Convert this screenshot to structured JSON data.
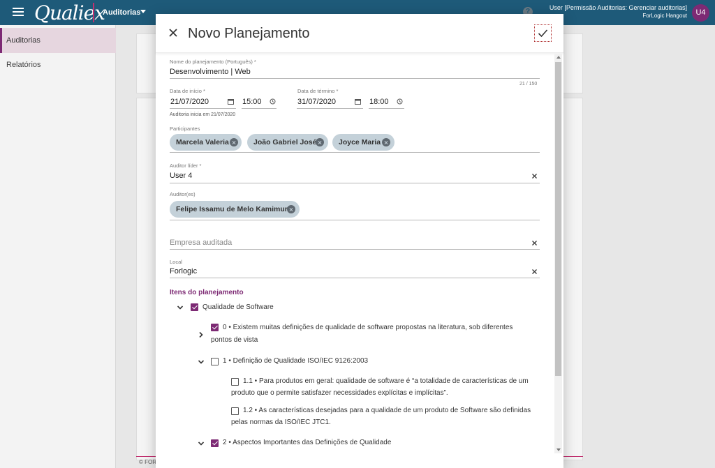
{
  "topbar": {
    "logo": "Qualiex",
    "module": "Auditorias",
    "help": "?",
    "user_name": "User [Permissão Auditorias: Gerenciar auditorias]",
    "user_company": "ForLogic Hangout",
    "avatar_initials": "U4"
  },
  "sidebar": {
    "items": [
      {
        "label": "Auditorias",
        "active": true
      },
      {
        "label": "Relatórios",
        "active": false
      }
    ]
  },
  "background": {
    "footer_text": "© FOR"
  },
  "dialog": {
    "title": "Novo Planejamento",
    "name_field": {
      "label": "Nome do planejamento (Português) *",
      "value": "Desenvolvimento | Web",
      "counter": "21 / 150"
    },
    "start_date": {
      "label": "Data de início *",
      "date": "21/07/2020",
      "time": "15:00",
      "hint": "Auditoria inicia em 21/07/2020"
    },
    "end_date": {
      "label": "Data de término *",
      "date": "31/07/2020",
      "time": "18:00"
    },
    "participants": {
      "label": "Participantes",
      "chips": [
        "Marcela Valeria",
        "João Gabriel José",
        "Joyce Maria"
      ]
    },
    "lead_auditor": {
      "label": "Auditor líder *",
      "value": "User 4"
    },
    "auditors": {
      "label": "Auditor(es)",
      "chips": [
        "Felipe Issamu de Melo Kamimura"
      ]
    },
    "company": {
      "placeholder": "Empresa auditada"
    },
    "location": {
      "label": "Local",
      "value": "Forlogic"
    },
    "items_section": {
      "title": "Itens do planejamento",
      "root": {
        "label": "Qualidade de Software",
        "checked": true
      },
      "item0": {
        "line1": "0 • Existem muitas definições de qualidade de software propostas na literatura, sob diferentes",
        "line2": "pontos de vista",
        "checked": true
      },
      "item1": {
        "label": "1 • Definição de Qualidade ISO/IEC 9126:2003",
        "checked": false
      },
      "item1_1": {
        "line1": "1.1 • Para produtos em geral: qualidade de software é “a totalidade de características de um",
        "line2": "produto que o permite satisfazer necessidades explícitas e implícitas”.",
        "checked": false
      },
      "item1_2": {
        "line1": "1.2 • As características desejadas para a qualidade de um produto de Software são definidas",
        "line2": "pelas normas da ISO/IEC JTC1.",
        "checked": false
      },
      "item2": {
        "label": "2 • Aspectos Importantes das Definições de Qualidade",
        "checked": true
      }
    }
  },
  "colors": {
    "topbar": "#1e5a79",
    "accent": "#7d2a74",
    "chip": "#c4d1d9"
  }
}
